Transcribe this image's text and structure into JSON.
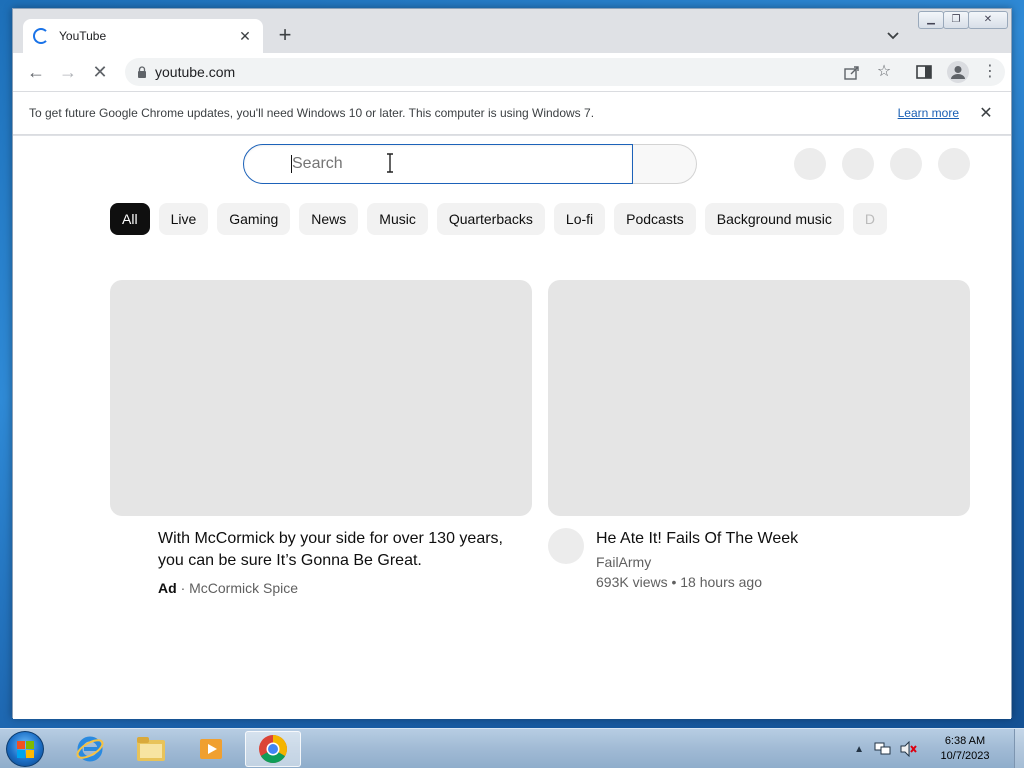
{
  "browser": {
    "tab_title": "YouTube",
    "url": "youtube.com",
    "infobar_message": "To get future Google Chrome updates, you'll need Windows 10 or later. This computer is using Windows 7.",
    "infobar_link": "Learn more"
  },
  "youtube": {
    "search_placeholder": "Search",
    "chips": [
      "All",
      "Live",
      "Gaming",
      "News",
      "Music",
      "Quarterbacks",
      "Lo-fi",
      "Podcasts",
      "Background music",
      "D"
    ],
    "videos": [
      {
        "title": "With McCormick by your side for over 130 years, you can be sure It’s Gonna Be Great.",
        "ad_label": "Ad",
        "separator": "·",
        "channel": "McCormick Spice"
      },
      {
        "title": "He Ate It! Fails Of The Week",
        "channel": "FailArmy",
        "stats": "693K views • 18 hours ago"
      }
    ]
  },
  "taskbar": {
    "time": "6:38 AM",
    "date": "10/7/2023"
  },
  "colors": {
    "accent": "#1a73e8",
    "chip_active": "#0f0f0f",
    "thumb_placeholder": "#e5e5e5"
  }
}
